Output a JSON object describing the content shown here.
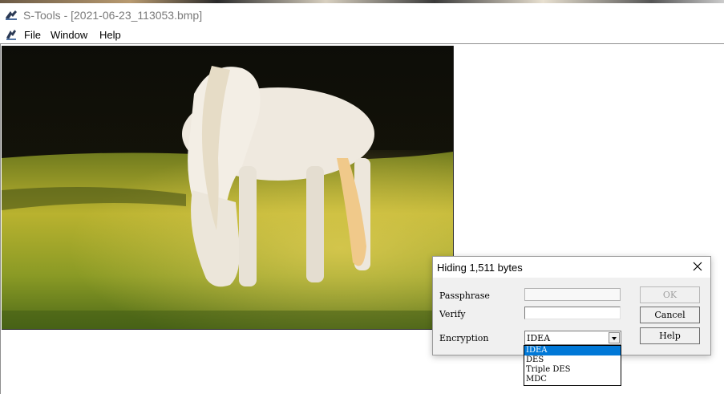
{
  "window": {
    "title": "S-Tools - [2021-06-23_113053.bmp]",
    "icon": "s-tools-app-icon"
  },
  "menu": {
    "icon": "document-mdi-icon",
    "items": [
      {
        "label": "File"
      },
      {
        "label": "Window"
      },
      {
        "label": "Help"
      }
    ]
  },
  "image": {
    "subject": "white-horse-grazing-photo"
  },
  "dialog": {
    "title": "Hiding 1,511 bytes",
    "close_icon": "close-icon",
    "passphrase_label": "Passphrase",
    "passphrase_value": "",
    "verify_label": "Verify",
    "verify_value": "",
    "encryption_label": "Encryption",
    "encryption_selected": "IDEA",
    "ok_label": "OK",
    "cancel_label": "Cancel",
    "help_label": "Help",
    "encryption_options": [
      "IDEA",
      "DES",
      "Triple DES",
      "MDC"
    ]
  },
  "colors": {
    "selection": "#0078d7",
    "dialog_bg": "#f0f0f0"
  }
}
